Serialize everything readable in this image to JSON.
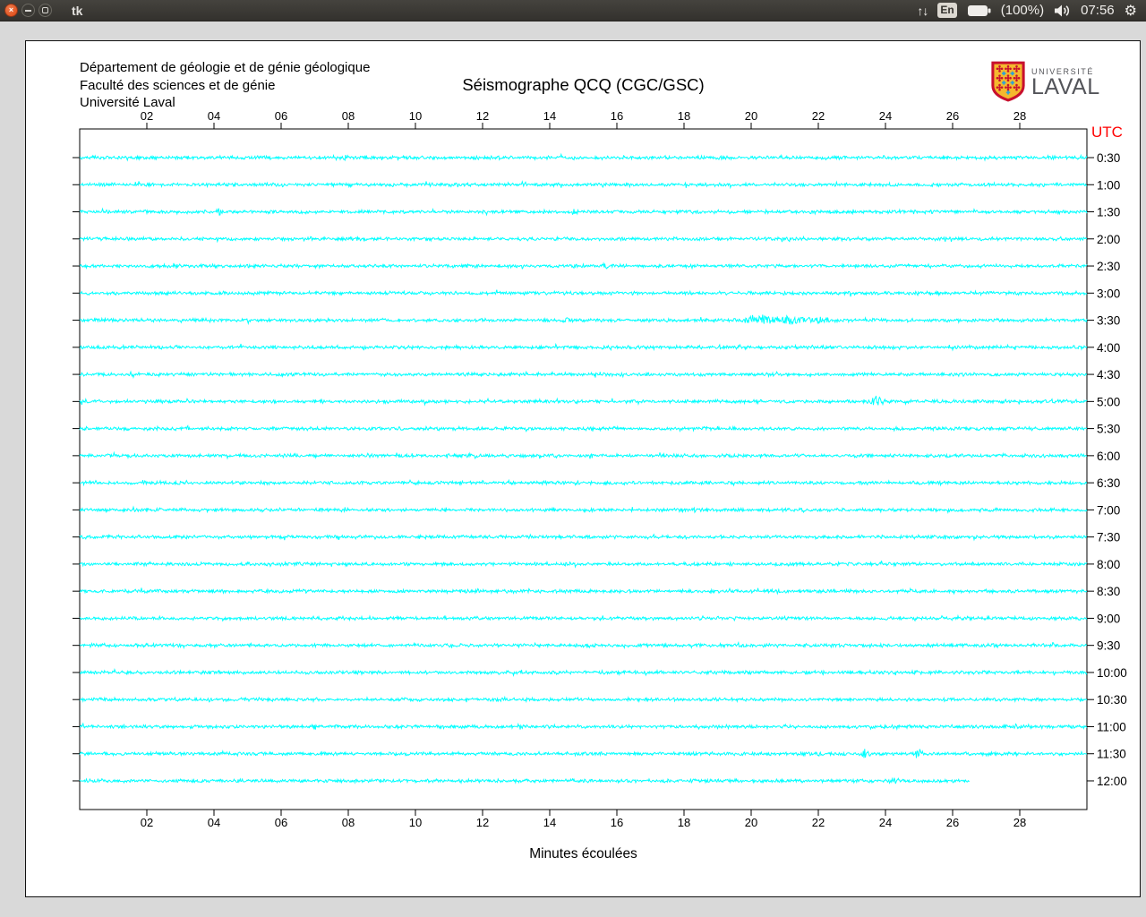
{
  "menubar": {
    "window_title": "tk",
    "keyboard_indicator": "En",
    "battery_label": "(100%)",
    "clock": "07:56"
  },
  "app_window": {
    "header_lines": [
      "Département de géologie et de génie géologique",
      "Faculté des sciences et de génie",
      "Université Laval"
    ],
    "title": "Séismographe QCQ (CGC/GSC)",
    "logo": {
      "small_text": "UNIVERSITÉ",
      "large_text": "LAVAL"
    },
    "xlabel": "Minutes écoulées"
  },
  "colors": {
    "trace": "#00ffff",
    "utc_label": "#ff0000",
    "axis": "#000000",
    "logo_gold": "#f5b82e",
    "logo_red": "#c8102e",
    "logo_blue": "#2aa0dc"
  },
  "chart_data": {
    "type": "line",
    "title": "Séismographe QCQ (CGC/GSC)",
    "xlabel": "Minutes écoulées",
    "x_min": 0,
    "x_max": 30,
    "x_tick_minutes": [
      2,
      4,
      6,
      8,
      10,
      12,
      14,
      16,
      18,
      20,
      22,
      24,
      26,
      28
    ],
    "x_tick_labels": [
      "02",
      "04",
      "06",
      "08",
      "10",
      "12",
      "14",
      "16",
      "18",
      "20",
      "22",
      "24",
      "26",
      "28"
    ],
    "right_axis_title": "UTC",
    "trace_color": "#00ffff",
    "base_noise_amp": 1.5,
    "rows": [
      {
        "utc": "0:30",
        "end_minute": 30,
        "events": [
          {
            "minute": 7.9,
            "width": 0.06,
            "amp": 1.5
          }
        ]
      },
      {
        "utc": "1:00",
        "end_minute": 30,
        "events": []
      },
      {
        "utc": "1:30",
        "end_minute": 30,
        "events": [
          {
            "minute": 4.15,
            "width": 0.05,
            "amp": 3.5
          },
          {
            "minute": 14.7,
            "width": 0.05,
            "amp": 3.5
          }
        ]
      },
      {
        "utc": "2:00",
        "end_minute": 30,
        "events": []
      },
      {
        "utc": "2:30",
        "end_minute": 30,
        "events": [
          {
            "minute": 15.65,
            "width": 0.1,
            "amp": 2
          }
        ]
      },
      {
        "utc": "3:00",
        "end_minute": 30,
        "events": []
      },
      {
        "utc": "3:30",
        "end_minute": 30,
        "events": [
          {
            "minute": 14.5,
            "width": 0.07,
            "amp": 2
          },
          {
            "minute": 20.2,
            "width": 0.4,
            "amp": 4.5
          },
          {
            "minute": 21.2,
            "width": 0.6,
            "amp": 3.5
          },
          {
            "minute": 22.15,
            "width": 0.2,
            "amp": 3.5
          }
        ]
      },
      {
        "utc": "4:00",
        "end_minute": 30,
        "events": [
          {
            "minute": 0.35,
            "width": 0.07,
            "amp": 3
          }
        ]
      },
      {
        "utc": "4:30",
        "end_minute": 30,
        "events": []
      },
      {
        "utc": "5:00",
        "end_minute": 30,
        "events": [
          {
            "minute": 23.75,
            "width": 0.15,
            "amp": 5
          }
        ]
      },
      {
        "utc": "5:30",
        "end_minute": 30,
        "events": []
      },
      {
        "utc": "6:00",
        "end_minute": 30,
        "events": []
      },
      {
        "utc": "6:30",
        "end_minute": 30,
        "events": []
      },
      {
        "utc": "7:00",
        "end_minute": 30,
        "events": []
      },
      {
        "utc": "7:30",
        "end_minute": 30,
        "events": []
      },
      {
        "utc": "8:00",
        "end_minute": 30,
        "events": []
      },
      {
        "utc": "8:30",
        "end_minute": 30,
        "events": []
      },
      {
        "utc": "9:00",
        "end_minute": 30,
        "events": []
      },
      {
        "utc": "9:30",
        "end_minute": 30,
        "events": []
      },
      {
        "utc": "10:00",
        "end_minute": 30,
        "events": [
          {
            "minute": 24.9,
            "width": 0.12,
            "amp": 2
          }
        ]
      },
      {
        "utc": "10:30",
        "end_minute": 30,
        "events": []
      },
      {
        "utc": "11:00",
        "end_minute": 30,
        "events": [
          {
            "minute": 7.0,
            "width": 0.05,
            "amp": 2.5
          }
        ]
      },
      {
        "utc": "11:30",
        "end_minute": 30,
        "events": [
          {
            "minute": 23.4,
            "width": 0.1,
            "amp": 4
          },
          {
            "minute": 25.0,
            "width": 0.1,
            "amp": 5.5
          }
        ]
      },
      {
        "utc": "12:00",
        "end_minute": 26.5,
        "events": [
          {
            "minute": 15.2,
            "width": 0.07,
            "amp": 2
          },
          {
            "minute": 24.3,
            "width": 0.18,
            "amp": 2.5
          }
        ]
      }
    ]
  }
}
